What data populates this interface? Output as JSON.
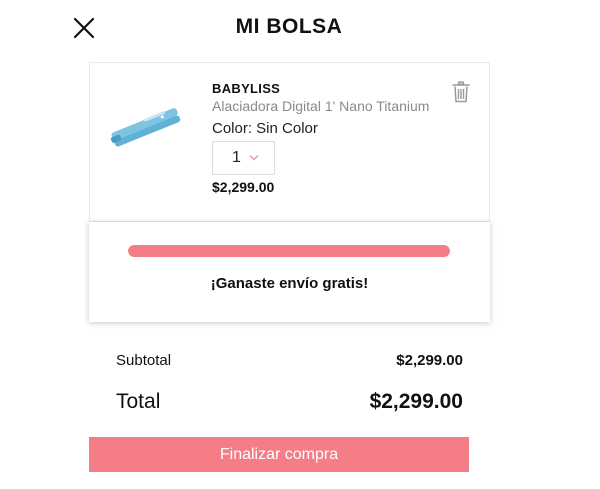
{
  "header": {
    "title": "MI BOLSA",
    "close_icon": "close-icon"
  },
  "cart": {
    "items": [
      {
        "brand": "BABYLISS",
        "name": "Alaciadora Digital 1' Nano Titanium",
        "color_text": "Color: Sin Color",
        "quantity": "1",
        "price": "$2,299.00",
        "image_icon": "hair-straightener-image",
        "remove_icon": "trash-icon"
      }
    ]
  },
  "shipping": {
    "progress": 1.0,
    "message": "¡Ganaste envío gratis!",
    "bar_color": "#f47d87"
  },
  "summary": {
    "subtotal_label": "Subtotal",
    "subtotal_value": "$2,299.00",
    "total_label": "Total",
    "total_value": "$2,299.00"
  },
  "checkout": {
    "label": "Finalizar compra",
    "color": "#f47d87"
  }
}
